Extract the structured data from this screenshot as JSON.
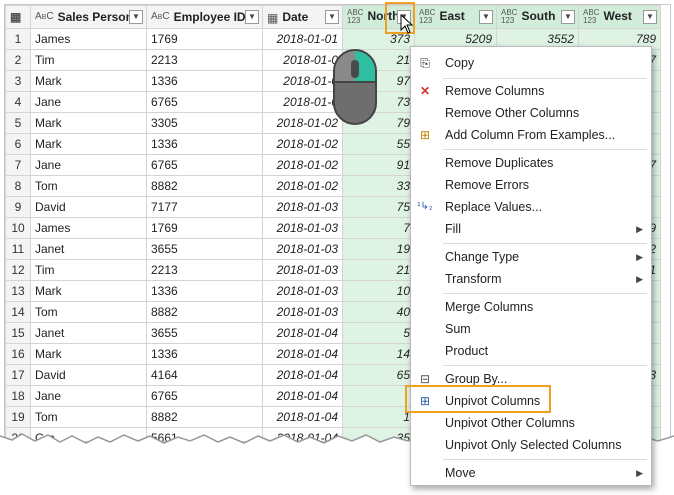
{
  "columns": [
    {
      "label": "Sales Person",
      "type": "ABC"
    },
    {
      "label": "Employee ID",
      "type": "ABC"
    },
    {
      "label": "Date",
      "type": "date"
    },
    {
      "label": "North",
      "type": "ABC123"
    },
    {
      "label": "East",
      "type": "ABC123"
    },
    {
      "label": "South",
      "type": "ABC123"
    },
    {
      "label": "West",
      "type": "ABC123"
    }
  ],
  "rows": [
    {
      "n": "1",
      "person": "James",
      "id": "1769",
      "date": "2018-01-01",
      "north": "373",
      "east": "5209",
      "south": "3552",
      "west": "789"
    },
    {
      "n": "2",
      "person": "Tim",
      "id": "2213",
      "date": "2018-01-0",
      "north": "21",
      "east": "",
      "south": "",
      "west": "07"
    },
    {
      "n": "3",
      "person": "Mark",
      "id": "1336",
      "date": "2018-01-0",
      "north": "97",
      "east": "",
      "south": "",
      "west": ""
    },
    {
      "n": "4",
      "person": "Jane",
      "id": "6765",
      "date": "2018-01-0",
      "north": "73",
      "east": "",
      "south": "",
      "west": ""
    },
    {
      "n": "5",
      "person": "Mark",
      "id": "3305",
      "date": "2018-01-02",
      "north": "79",
      "east": "",
      "south": "",
      "west": ""
    },
    {
      "n": "6",
      "person": "Mark",
      "id": "1336",
      "date": "2018-01-02",
      "north": "55",
      "east": "",
      "south": "",
      "west": ""
    },
    {
      "n": "7",
      "person": "Jane",
      "id": "6765",
      "date": "2018-01-02",
      "north": "91",
      "east": "",
      "south": "",
      "west": "57"
    },
    {
      "n": "8",
      "person": "Tom",
      "id": "8882",
      "date": "2018-01-02",
      "north": "33",
      "east": "",
      "south": "",
      "west": ""
    },
    {
      "n": "9",
      "person": "David",
      "id": "7177",
      "date": "2018-01-03",
      "north": "75",
      "east": "",
      "south": "",
      "west": ""
    },
    {
      "n": "10",
      "person": "James",
      "id": "1769",
      "date": "2018-01-03",
      "north": "7",
      "east": "",
      "south": "",
      "west": "29"
    },
    {
      "n": "11",
      "person": "Janet",
      "id": "3655",
      "date": "2018-01-03",
      "north": "19",
      "east": "",
      "south": "",
      "west": "52"
    },
    {
      "n": "12",
      "person": "Tim",
      "id": "2213",
      "date": "2018-01-03",
      "north": "21",
      "east": "",
      "south": "",
      "west": "41"
    },
    {
      "n": "13",
      "person": "Mark",
      "id": "1336",
      "date": "2018-01-03",
      "north": "10",
      "east": "",
      "south": "",
      "west": ""
    },
    {
      "n": "14",
      "person": "Tom",
      "id": "8882",
      "date": "2018-01-03",
      "north": "40",
      "east": "",
      "south": "",
      "west": ""
    },
    {
      "n": "15",
      "person": "Janet",
      "id": "3655",
      "date": "2018-01-04",
      "north": "5",
      "east": "",
      "south": "",
      "west": ""
    },
    {
      "n": "16",
      "person": "Mark",
      "id": "1336",
      "date": "2018-01-04",
      "north": "14",
      "east": "",
      "south": "",
      "west": ""
    },
    {
      "n": "17",
      "person": "David",
      "id": "4164",
      "date": "2018-01-04",
      "north": "65",
      "east": "",
      "south": "",
      "west": "53"
    },
    {
      "n": "18",
      "person": "Jane",
      "id": "6765",
      "date": "2018-01-04",
      "north": "",
      "east": "",
      "south": "",
      "west": ""
    },
    {
      "n": "19",
      "person": "Tom",
      "id": "8882",
      "date": "2018-01-04",
      "north": "1",
      "east": "",
      "south": "",
      "west": ""
    },
    {
      "n": "20",
      "person": "Gra",
      "id": "5661",
      "date": "2018-01-04",
      "north": "35",
      "east": "",
      "south": "",
      "west": ""
    }
  ],
  "menu": {
    "copy": "Copy",
    "remove_columns": "Remove Columns",
    "remove_other_columns": "Remove Other Columns",
    "add_column_from_examples": "Add Column From Examples...",
    "remove_duplicates": "Remove Duplicates",
    "remove_errors": "Remove Errors",
    "replace_values": "Replace Values...",
    "fill": "Fill",
    "change_type": "Change Type",
    "transform": "Transform",
    "merge_columns": "Merge Columns",
    "sum": "Sum",
    "product": "Product",
    "group_by": "Group By...",
    "unpivot_columns": "Unpivot Columns",
    "unpivot_other_columns": "Unpivot Other Columns",
    "unpivot_only_selected": "Unpivot Only Selected Columns",
    "move": "Move"
  },
  "icons": {
    "copy": "copy-icon",
    "remove_columns": "remove-columns-icon",
    "add_column": "add-column-icon",
    "replace_values": "replace-values-icon",
    "group_by": "group-by-icon",
    "unpivot": "unpivot-icon",
    "mouse": "mouse-right-click-icon"
  },
  "colors": {
    "selected_column": "#dff3e5",
    "highlight": "#f0a020",
    "mouse_button": "#2dbfa0"
  }
}
